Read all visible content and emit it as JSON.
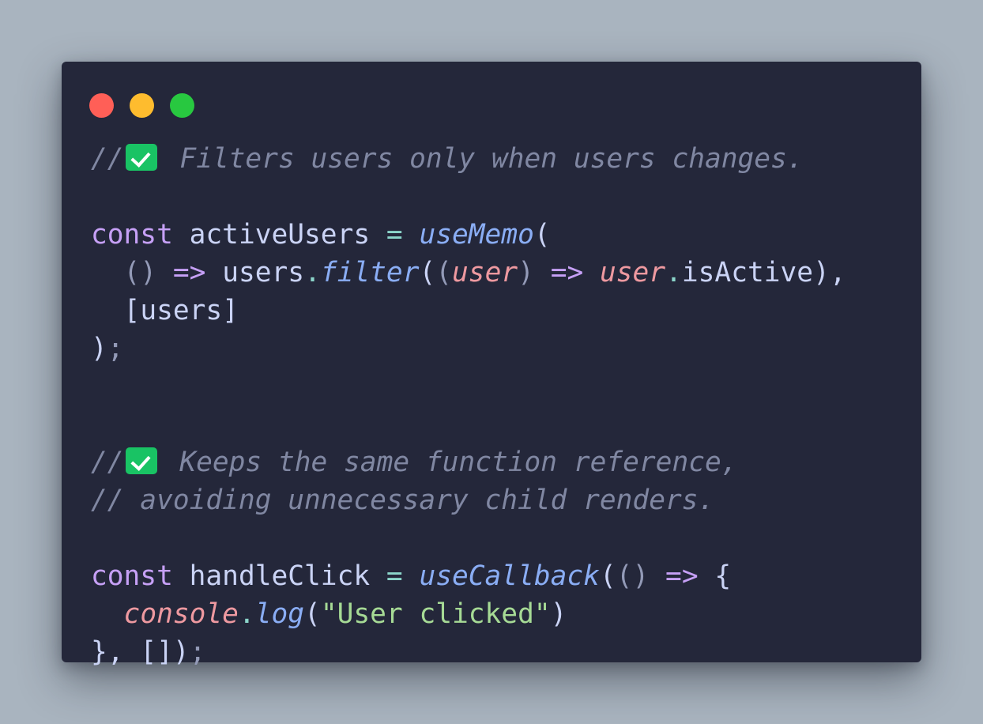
{
  "window": {
    "controls": [
      "close",
      "minimize",
      "maximize"
    ]
  },
  "code": {
    "comment1_prefix": "//",
    "comment1_text": " Filters users only when users changes.",
    "line_const": "const",
    "line_activeUsers": " activeUsers ",
    "line_eq": "=",
    "line_useMemo": "useMemo",
    "line_open_paren": "(",
    "line_indent": "  ",
    "arrow_parens": "()",
    "arrow": "=>",
    "users_word": "users",
    "dot": ".",
    "filter_fn": "filter",
    "paren_open": "(",
    "paren_open2": "(",
    "user_param": "user",
    "paren_close": ")",
    "user_ref": "user",
    "isActive": "isActive",
    "close_paren_comma": "),",
    "deps_users": "[users]",
    "close_paren": ")",
    "semicolon": ";",
    "comment2_prefix": "//",
    "comment2_text": " Keeps the same function reference,",
    "comment3_text": "// avoiding unnecessary child renders.",
    "handleClick": " handleClick ",
    "useCallback": "useCallback",
    "brace_open": "{",
    "console_obj": "console",
    "log_fn": "log",
    "log_string": "\"User clicked\"",
    "brace_close_comma": "}, ",
    "empty_deps": "[]",
    "final_close": ")"
  },
  "colors": {
    "background": "#a9b4bf",
    "editor_bg": "#24273a",
    "comment": "#8087a2",
    "keyword": "#c6a0f6",
    "function": "#8aadf4",
    "operator": "#8bd5ca",
    "parameter": "#ee99a0",
    "string": "#a6da95",
    "text": "#cad3f5",
    "check_badge": "#19c364"
  },
  "icons": {
    "check": "white-check-mark-icon"
  }
}
